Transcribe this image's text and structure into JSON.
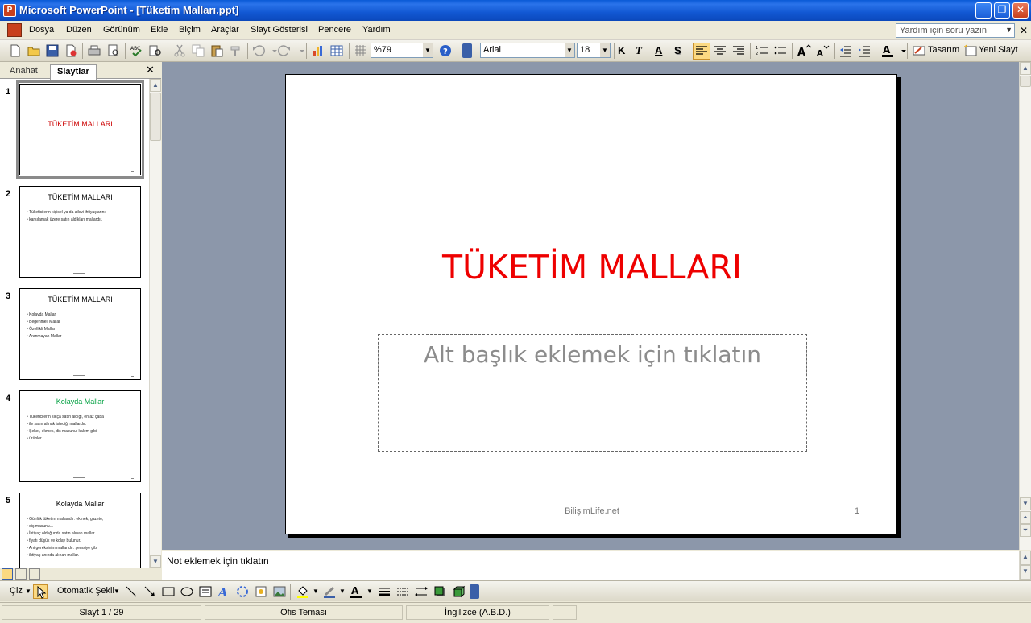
{
  "window": {
    "title": "Microsoft PowerPoint - [Tüketim Malları.ppt]",
    "minimize": "_",
    "maximize": "❐",
    "close": "✕"
  },
  "menu": {
    "items": [
      "Dosya",
      "Düzen",
      "Görünüm",
      "Ekle",
      "Biçim",
      "Araçlar",
      "Slayt Gösterisi",
      "Pencere",
      "Yardım"
    ],
    "help_placeholder": "Yardım için soru yazın",
    "doc_close": "✕"
  },
  "toolbar": {
    "zoom": "%79",
    "font_name": "Arial",
    "font_size": "18",
    "bold": "K",
    "italic": "T",
    "underline": "A",
    "shadow": "S",
    "design_label": "Tasarım",
    "new_slide_label": "Yeni Slayt"
  },
  "left_panel": {
    "tab_outline": "Anahat",
    "tab_slides": "Slaytlar",
    "close": "✕",
    "thumbnails": [
      {
        "number": "1",
        "title": "TÜKETİM MALLARI",
        "title_color": "#cc0000",
        "bullets": []
      },
      {
        "number": "2",
        "title": "TÜKETİM MALLARI",
        "title_color": "#000000",
        "bullets": [
          "Tüketicilerin kişisel ya da ailevi ihtiyaçlarını",
          "karşılamak üzere satın aldıkları mallardır."
        ]
      },
      {
        "number": "3",
        "title": "TÜKETİM MALLARI",
        "title_color": "#000000",
        "bullets": [
          "Kolayda Mallar",
          "Beğenmeli Mallar",
          "Özellikli Mallar",
          "Aranmayan Mallar"
        ]
      },
      {
        "number": "4",
        "title": "Kolayda Mallar",
        "title_color": "#00a040",
        "bullets": [
          "Tüketicilerin sıkça satın aldığı, en az çaba",
          "ile satın almak istediği mallardır.",
          "Şeker, ekmek, diş macunu, kalem gibi",
          "ürünler."
        ]
      },
      {
        "number": "5",
        "title": "Kolayda Mallar",
        "title_color": "#000000",
        "bullets": [
          "Günlük tüketim mallarıdır: ekmek, gazete,",
          "diş macunu...",
          "İhtiyaç olduğunda satın alınan mallar",
          "fiyatı düşük ve kolay bulunur.",
          "Ani gereksinim mallarıdır: şemsiye gibi",
          "ihtiyaç anında alınan mallar."
        ]
      }
    ]
  },
  "slide": {
    "title": "TÜKETİM MALLARI",
    "subtitle_placeholder": "Alt başlık eklemek için tıklatın",
    "footer": "BilişimLife.net",
    "number": "1"
  },
  "notes": {
    "placeholder": "Not eklemek için tıklatın"
  },
  "draw_toolbar": {
    "draw_label": "Çiz",
    "autoshapes_label": "Otomatik Şekil"
  },
  "status": {
    "slide": "Slayt 1 / 29",
    "theme": "Ofis Teması",
    "language": "İngilizce (A.B.D.)"
  },
  "colors": {
    "title_red": "#ee0000",
    "edit_bg": "#8c97aa",
    "xp_blue": "#0a5ad6"
  }
}
